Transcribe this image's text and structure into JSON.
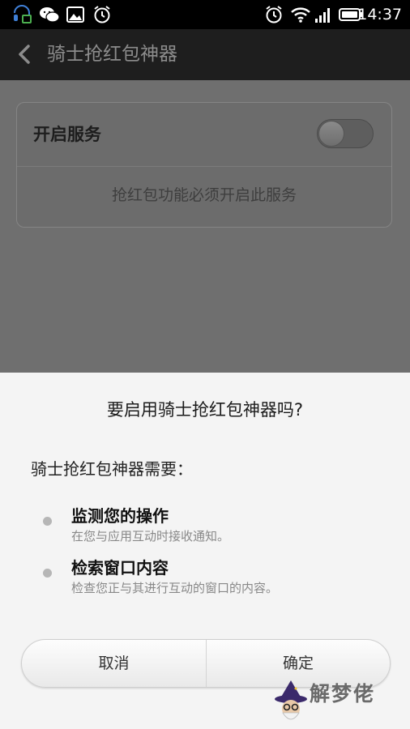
{
  "status_bar": {
    "time": "14:37",
    "icons": [
      "notification-app-icon",
      "wechat-icon",
      "image-icon",
      "alarm-icon",
      "alarm-icon",
      "wifi-icon",
      "signal-icon",
      "battery-icon"
    ]
  },
  "action_bar": {
    "back_icon": "chevron-left-icon",
    "title": "骑士抢红包神器"
  },
  "settings_card": {
    "service_label": "开启服务",
    "toggle_on": false,
    "description": "抢红包功能必须开启此服务"
  },
  "dialog": {
    "title": "要启用骑士抢红包神器吗?",
    "intro": "骑士抢红包神器需要：",
    "permissions": [
      {
        "title": "监测您的操作",
        "description": "在您与应用互动时接收通知。"
      },
      {
        "title": "检索窗口内容",
        "description": "检查您正与其进行互动的窗口的内容。"
      }
    ],
    "cancel_label": "取消",
    "ok_label": "确定"
  },
  "watermark": {
    "text": "解梦佬"
  }
}
